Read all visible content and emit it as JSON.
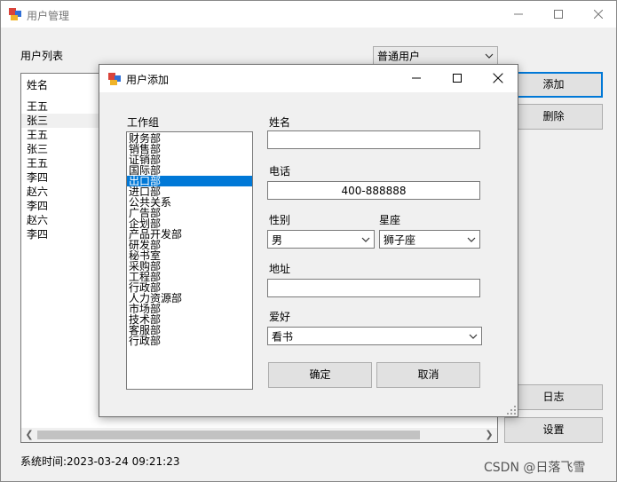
{
  "main": {
    "title": "用户管理",
    "user_list_label": "用户列表",
    "user_type_select": "普通用户",
    "list_header": "姓名",
    "users": [
      "王五",
      "张三",
      "王五",
      "张三",
      "王五",
      "李四",
      "赵六",
      "李四",
      "赵六",
      "李四"
    ],
    "selected_user_index": 1,
    "buttons": {
      "add": "添加",
      "delete": "删除",
      "log": "日志",
      "settings": "设置"
    },
    "status_time": "系统时间:2023-03-24 09:21:23",
    "watermark": "CSDN @日落飞雪"
  },
  "dialog": {
    "title": "用户添加",
    "workgroup_label": "工作组",
    "departments": [
      "财务部",
      "销售部",
      "证销部",
      "国际部",
      "出口部",
      "进口部",
      "公共关系",
      "广告部",
      "企划部",
      "产品开发部",
      "研发部",
      "秘书室",
      "采购部",
      "工程部",
      "行政部",
      "人力资源部",
      "市场部",
      "技术部",
      "客服部",
      "行政部"
    ],
    "selected_department_index": 4,
    "name_label": "姓名",
    "name_value": "",
    "phone_label": "电话",
    "phone_value": "400-888888",
    "gender_label": "性别",
    "gender_value": "男",
    "zodiac_label": "星座",
    "zodiac_value": "狮子座",
    "address_label": "地址",
    "address_value": "",
    "hobby_label": "爱好",
    "hobby_value": "看书",
    "ok_button": "确定",
    "cancel_button": "取消"
  },
  "colors": {
    "selection": "#0078d7",
    "focus_border": "#0078d7",
    "window_bg": "#f0f0f0"
  }
}
